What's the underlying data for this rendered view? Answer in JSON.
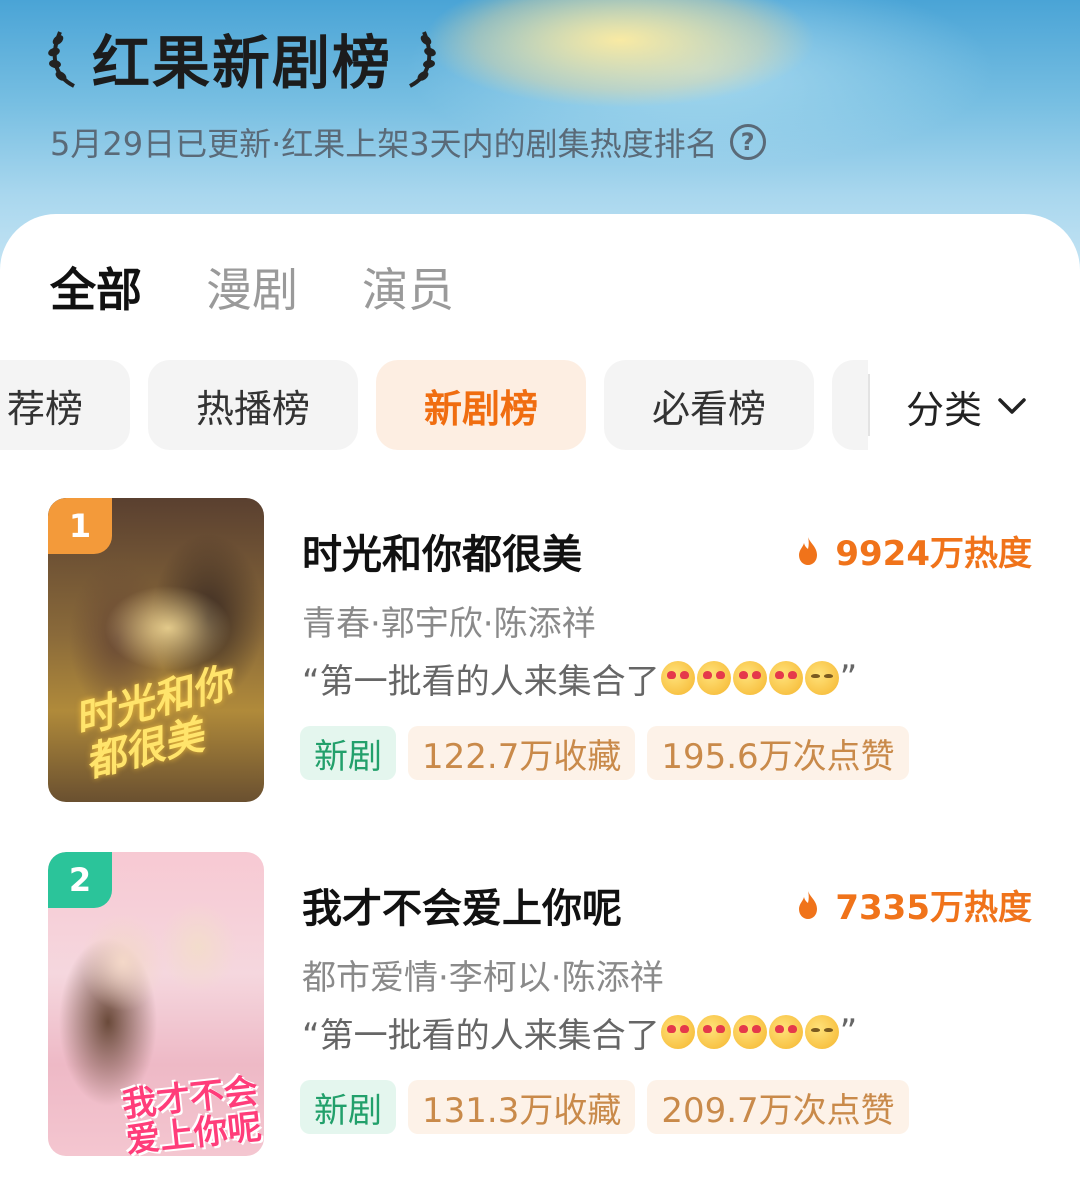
{
  "header": {
    "title": "红果新剧榜",
    "subtitle": "5月29日已更新·红果上架3天内的剧集热度排名"
  },
  "main_tabs": [
    {
      "label": "全部",
      "active": true
    },
    {
      "label": "漫剧",
      "active": false
    },
    {
      "label": "演员",
      "active": false
    }
  ],
  "chips": [
    {
      "label": "荐榜",
      "active": false
    },
    {
      "label": "热播榜",
      "active": false
    },
    {
      "label": "新剧榜",
      "active": true
    },
    {
      "label": "必看榜",
      "active": false
    }
  ],
  "category": {
    "label": "分类"
  },
  "items": [
    {
      "rank": "1",
      "rank_color": "#f39a3a",
      "title": "时光和你都很美",
      "heat": "9924万热度",
      "meta": "青春·郭宇欣·陈添祥",
      "quote": "“第一批看的人来集合了",
      "quote_end": "”",
      "poster_text": "时光和你都很美",
      "tags": [
        "新剧",
        "122.7万收藏",
        "195.6万次点赞"
      ]
    },
    {
      "rank": "2",
      "rank_color": "#2bc49a",
      "title": "我才不会爱上你呢",
      "heat": "7335万热度",
      "meta": "都市爱情·李柯以·陈添祥",
      "quote": "“第一批看的人来集合了",
      "quote_end": "”",
      "poster_text": "我才不会爱上你呢",
      "tags": [
        "新剧",
        "131.3万收藏",
        "209.7万次点赞"
      ]
    }
  ]
}
